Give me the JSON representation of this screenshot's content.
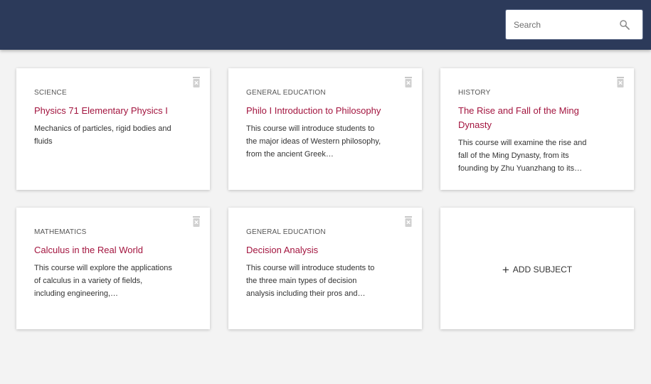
{
  "header": {
    "search": {
      "placeholder": "Search",
      "value": "",
      "icon": "search-icon"
    },
    "background_color": "#2c3a5a"
  },
  "subjects": [
    {
      "category": "SCIENCE",
      "title": "Physics 71 Elementary Physics I",
      "description": "Mechanics of particles, rigid bodies and fluids"
    },
    {
      "category": "GENERAL EDUCATION",
      "title": "Philo I Introduction to Philosophy",
      "description": "This course will introduce students to the major ideas of Western philosophy, from the ancient Greek…"
    },
    {
      "category": "HISTORY",
      "title": "The Rise and Fall of the Ming Dynasty",
      "description": "This course will examine the rise and fall of the Ming Dynasty, from its founding by Zhu Yuanzhang to its…"
    },
    {
      "category": "MATHEMATICS",
      "title": "Calculus in the Real World",
      "description": "This course will explore the applications of calculus in a variety of fields, including engineering,…"
    },
    {
      "category": "GENERAL EDUCATION",
      "title": "Decision Analysis",
      "description": "This course will introduce students to the three main types of decision analysis including their pros and…"
    }
  ],
  "add_card": {
    "label": "ADD SUBJECT",
    "icon": "plus-icon"
  },
  "colors": {
    "title_accent": "#a3153f",
    "page_background": "#f3f3f3"
  }
}
